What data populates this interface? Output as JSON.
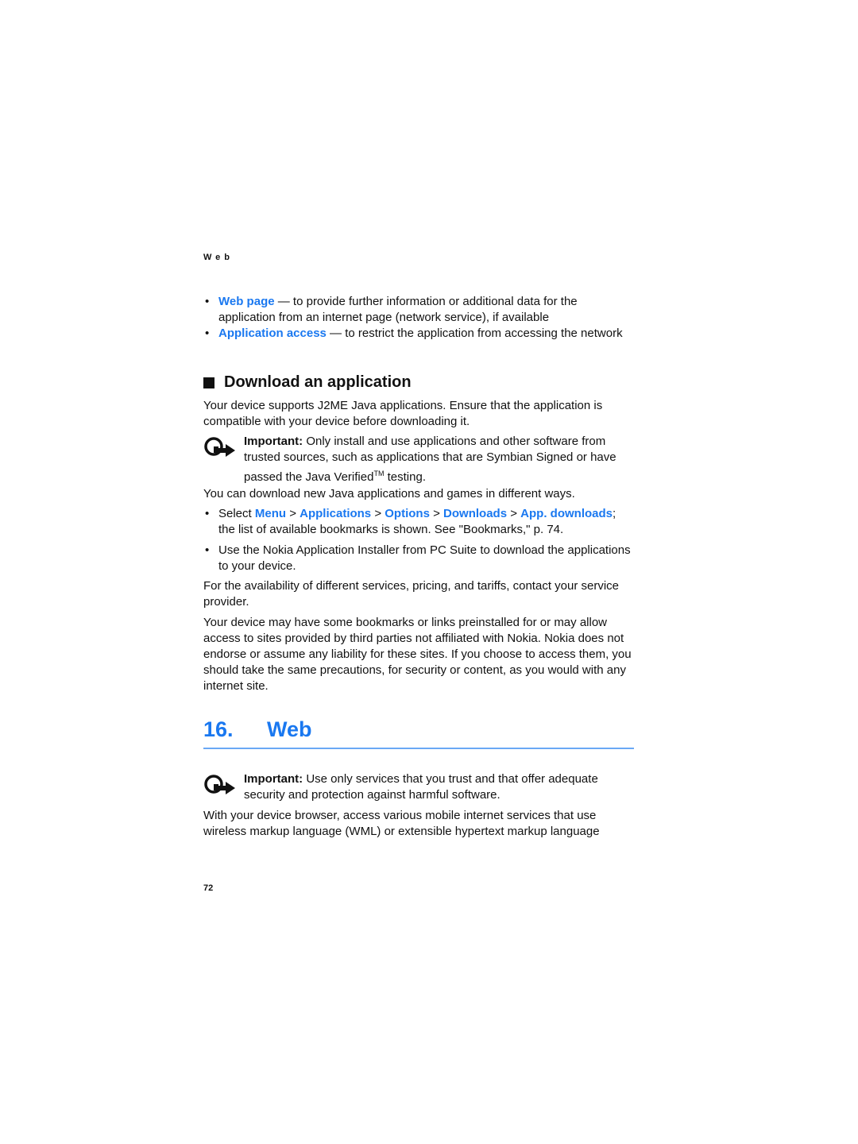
{
  "running_head": "Web",
  "top_bullets": [
    {
      "term": "Web page",
      "sep": " — ",
      "text": " to provide further information or additional data for the application from an internet page (network service), if available"
    },
    {
      "term": "Application access",
      "sep": " — ",
      "text": " to restrict the application from accessing the network"
    }
  ],
  "section": {
    "title": "Download an application",
    "intro": "Your device supports J2ME Java applications. Ensure that the application is compatible with your device before downloading it.",
    "note": {
      "icon": "important-icon",
      "label": "Important:",
      "text_before_tm": "  Only install and use applications and other software from trusted sources, such as applications that are Symbian Signed or have passed the Java Verified",
      "tm": "TM",
      "text_after_tm": " testing."
    },
    "para2": "You can download new Java applications and games in different ways.",
    "bullets": {
      "select_prefix": "Select ",
      "path": [
        "Menu",
        "Applications",
        "Options",
        "Downloads",
        "App. downloads"
      ],
      "path_sep": " > ",
      "select_suffix": "; the list of available bookmarks is shown. See \"Bookmarks,\" p. 74.",
      "second": "Use the Nokia Application Installer from PC Suite to download the applications to your device."
    },
    "para3": "For the availability of different services, pricing, and tariffs, contact your service provider.",
    "para4": "Your device may have some bookmarks or links preinstalled for or may allow access to sites provided by third parties not affiliated with Nokia. Nokia does not endorse or assume any liability for these sites. If you choose to access them, you should take the same precautions, for security or content, as you would with any internet site."
  },
  "chapter": {
    "number": "16.",
    "title": "Web",
    "note": {
      "icon": "important-icon",
      "label": "Important:",
      "text": "  Use only services that you trust and that offer adequate security and protection against harmful software."
    },
    "para": "With your device browser, access various mobile internet services that use wireless markup language (WML) or extensible hypertext markup language"
  },
  "page_number": "72",
  "colors": {
    "accent": "#1a78f0",
    "rule": "#6aa8f5",
    "text": "#111111"
  }
}
